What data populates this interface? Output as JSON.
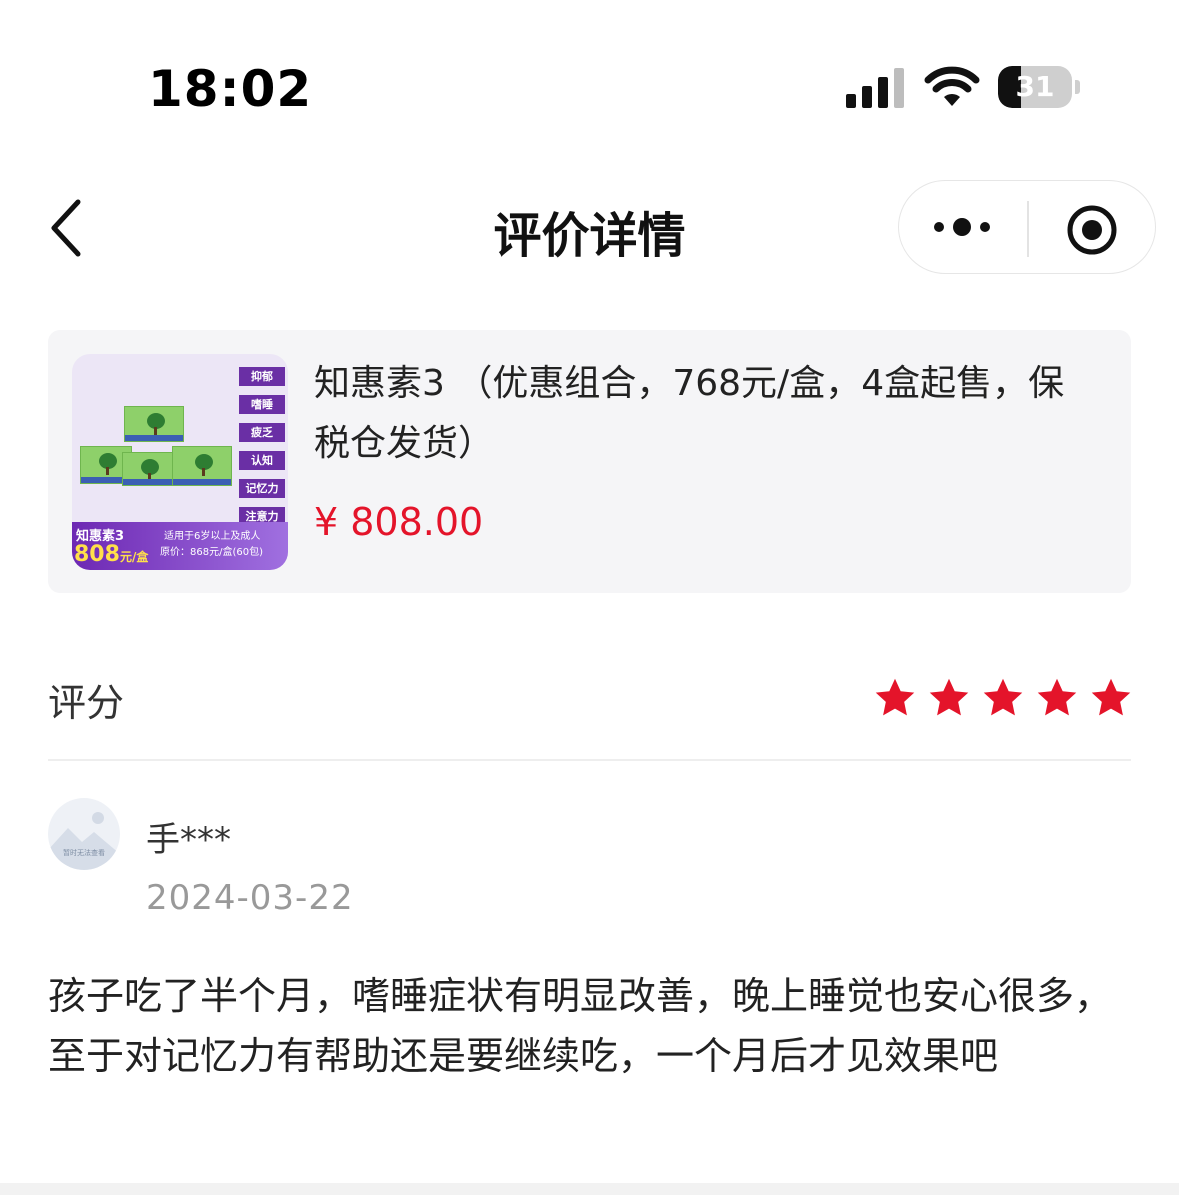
{
  "status_bar": {
    "time": "18:02",
    "battery_level": "31",
    "battery_fraction": 0.31
  },
  "nav": {
    "title": "评价详情",
    "back_icon": "chevron-left-icon",
    "more_icon": "more-dots-icon",
    "close_icon": "target-close-icon"
  },
  "product": {
    "title": "知惠素3 （优惠组合，768元/盒，4盒起售，保税仓发货）",
    "price": "¥ 808.00",
    "image": {
      "tags": [
        "抑郁",
        "嗜睡",
        "疲乏",
        "认知",
        "记忆力",
        "注意力"
      ],
      "name": "知惠素3",
      "price": "808",
      "unit": "元/盒",
      "line1": "适用于6岁以上及成人",
      "line2": "原价：868元/盒(60包)"
    }
  },
  "rating": {
    "label": "评分",
    "stars": 5,
    "max": 5,
    "star_color": "#e4142a"
  },
  "review": {
    "username": "手***",
    "date": "2024-03-22",
    "avatar_caption": "暂时无法查看",
    "text": "孩子吃了半个月，嗜睡症状有明显改善，晚上睡觉也安心很多，至于对记忆力有帮助还是要继续吃，一个月后才见效果吧"
  }
}
